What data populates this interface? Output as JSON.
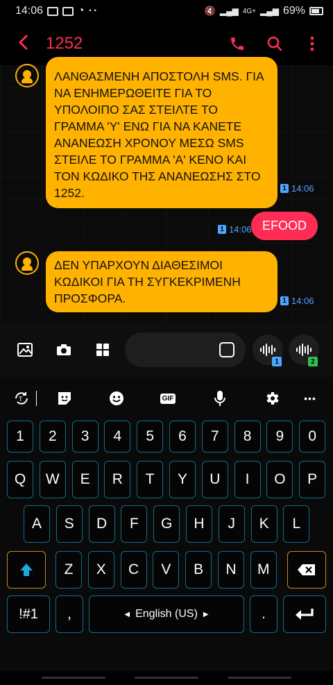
{
  "status_bar": {
    "time": "14:06",
    "network": "4G+",
    "battery": "69%"
  },
  "header": {
    "title": "1252"
  },
  "messages": [
    {
      "direction": "incoming",
      "text": "ΛΑΝΘΑΣΜΕΝΗ ΑΠΟΣΤΟΛΗ SMS. ΓΙΑ ΝΑ ΕΝΗΜΕΡΩΘΕΙΤΕ ΓΙΑ ΤΟ ΥΠΟΛΟΙΠΟ ΣΑΣ ΣΤΕΙΛΤΕ ΤΟ ΓΡΑΜΜΑ 'Υ' ΕΝΩ ΓΙΑ ΝΑ ΚΑΝΕΤΕ ΑΝΑΝΕΩΣΗ ΧΡΟΝΟΥ ΜΕΣΩ SMS ΣΤΕΙΛΕ ΤΟ ΓΡΑΜΜΑ 'Α' ΚΕΝΟ ΚΑΙ ΤΟΝ ΚΩΔΙΚΟ ΤΗΣ ΑΝΑΝΕΩΣΗΣ ΣΤΟ 1252.",
      "sim": "1",
      "time": "14:06"
    },
    {
      "direction": "outgoing",
      "text": "EFOOD",
      "sim": "1",
      "time": "14:06"
    },
    {
      "direction": "incoming",
      "text": "ΔΕΝ ΥΠΑΡΧΟΥΝ ΔΙΑΘΕΣΙΜΟΙ ΚΩΔΙΚΟΙ ΓΙΑ ΤΗ ΣΥΓΚΕΚΡΙΜΕΝΗ ΠΡΟΣΦΟΡΑ.",
      "sim": "1",
      "time": "14:06"
    }
  ],
  "composer": {
    "voice_sim_1": "1",
    "voice_sim_2": "2",
    "sim1_color": "#4ea6ff",
    "sim2_color": "#2fbf4f"
  },
  "keyboard": {
    "toolbar_gif": "GIF",
    "row_numbers": [
      "1",
      "2",
      "3",
      "4",
      "5",
      "6",
      "7",
      "8",
      "9",
      "0"
    ],
    "row_1": [
      "Q",
      "W",
      "E",
      "R",
      "T",
      "Y",
      "U",
      "I",
      "O",
      "P"
    ],
    "row_2": [
      "A",
      "S",
      "D",
      "F",
      "G",
      "H",
      "J",
      "K",
      "L"
    ],
    "row_3": [
      "Z",
      "X",
      "C",
      "V",
      "B",
      "N",
      "M"
    ],
    "symbols_label": "!#1",
    "comma_label": ",",
    "space_label": "English (US)",
    "period_label": "."
  },
  "colors": {
    "accent": "#ff2d55",
    "incoming_bubble": "#ffb300",
    "key_border": "#0e6f8a",
    "special_key_border": "#c88a1e"
  }
}
